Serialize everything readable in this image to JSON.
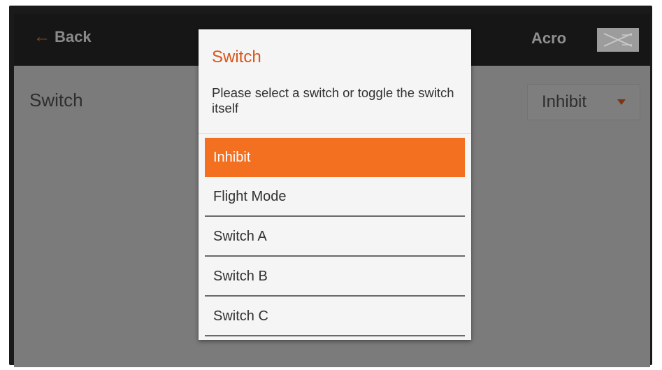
{
  "header": {
    "back_label": "Back",
    "mode_label": "Acro",
    "model_icon": "airplane-icon"
  },
  "main": {
    "row_label": "Switch",
    "select_value": "Inhibit"
  },
  "dialog": {
    "title": "Switch",
    "message": "Please select a switch or toggle the switch itself",
    "items": [
      {
        "label": "Inhibit",
        "selected": true
      },
      {
        "label": "Flight Mode",
        "selected": false
      },
      {
        "label": "Switch A",
        "selected": false
      },
      {
        "label": "Switch B",
        "selected": false
      },
      {
        "label": "Switch C",
        "selected": false
      }
    ]
  },
  "colors": {
    "accent": "#f37021",
    "title": "#d9561b",
    "overlay_bg": "#7b7b7b",
    "topbar_bg": "#161616"
  }
}
